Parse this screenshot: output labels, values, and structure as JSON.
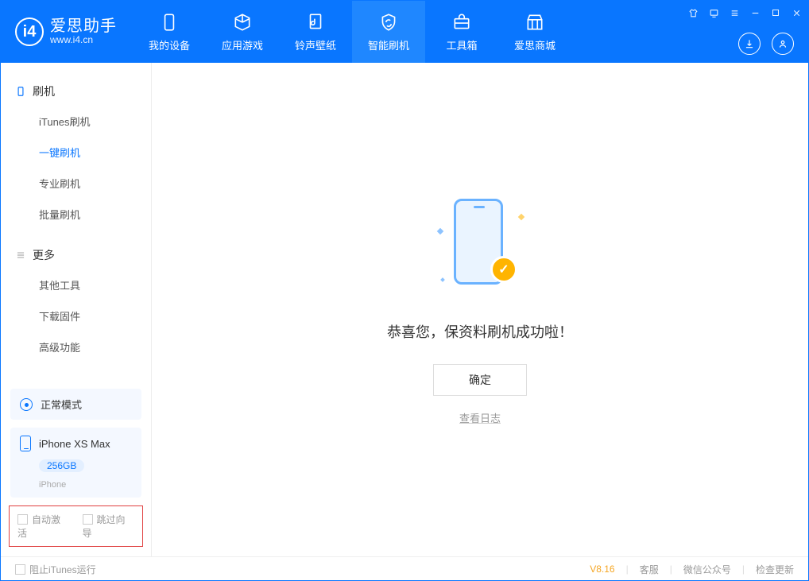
{
  "app": {
    "name_cn": "爱思助手",
    "name_en": "www.i4.cn"
  },
  "nav": {
    "tabs": [
      {
        "label": "我的设备"
      },
      {
        "label": "应用游戏"
      },
      {
        "label": "铃声壁纸"
      },
      {
        "label": "智能刷机"
      },
      {
        "label": "工具箱"
      },
      {
        "label": "爱思商城"
      }
    ]
  },
  "sidebar": {
    "group1": {
      "title": "刷机",
      "items": [
        "iTunes刷机",
        "一键刷机",
        "专业刷机",
        "批量刷机"
      ]
    },
    "group2": {
      "title": "更多",
      "items": [
        "其他工具",
        "下载固件",
        "高级功能"
      ]
    },
    "mode_label": "正常模式",
    "device": {
      "name": "iPhone XS Max",
      "capacity": "256GB",
      "type": "iPhone"
    },
    "checkboxes": {
      "auto_activate": "自动激活",
      "skip_guide": "跳过向导"
    }
  },
  "main": {
    "success_message": "恭喜您，保资料刷机成功啦！",
    "ok_button": "确定",
    "view_log": "查看日志"
  },
  "footer": {
    "block_itunes": "阻止iTunes运行",
    "version": "V8.16",
    "links": [
      "客服",
      "微信公众号",
      "检查更新"
    ]
  }
}
